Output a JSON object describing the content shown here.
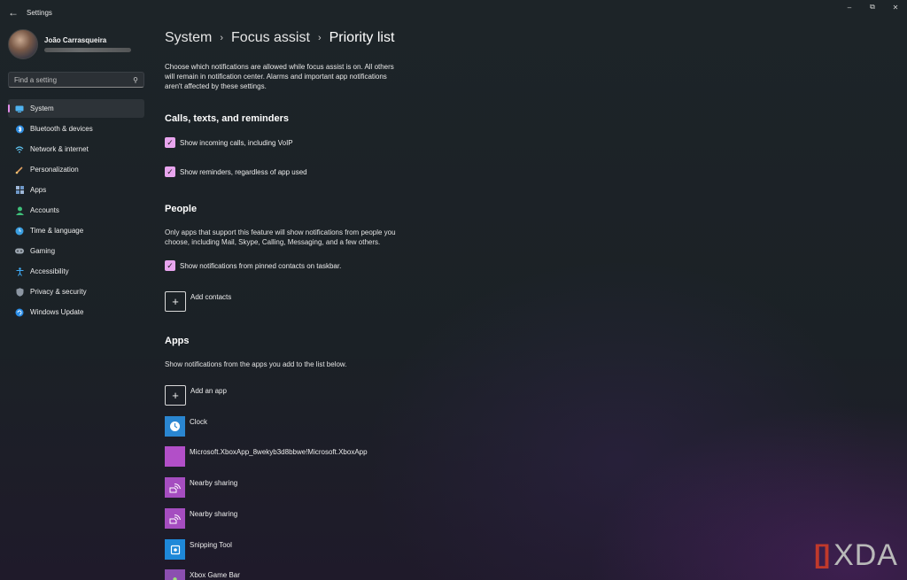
{
  "titlebar": {
    "back_icon": "back-arrow-icon",
    "title": "Settings",
    "controls": [
      "minimize-icon",
      "maximize-icon",
      "close-icon"
    ]
  },
  "profile": {
    "name": "João Carrasqueira"
  },
  "search": {
    "placeholder": "Find a setting",
    "icon": "search-icon"
  },
  "nav": {
    "accent": "#e28ce9",
    "items": [
      {
        "label": "System",
        "icon": "monitor-icon",
        "active": true
      },
      {
        "label": "Bluetooth & devices",
        "icon": "bluetooth-icon"
      },
      {
        "label": "Network & internet",
        "icon": "wifi-icon"
      },
      {
        "label": "Personalization",
        "icon": "brush-icon"
      },
      {
        "label": "Apps",
        "icon": "apps-grid-icon"
      },
      {
        "label": "Accounts",
        "icon": "person-icon"
      },
      {
        "label": "Time & language",
        "icon": "globe-clock-icon"
      },
      {
        "label": "Gaming",
        "icon": "gamepad-icon"
      },
      {
        "label": "Accessibility",
        "icon": "accessibility-icon"
      },
      {
        "label": "Privacy & security",
        "icon": "shield-icon"
      },
      {
        "label": "Windows Update",
        "icon": "refresh-icon"
      }
    ]
  },
  "breadcrumb": {
    "items": [
      "System",
      "Focus assist",
      "Priority list"
    ]
  },
  "intro": "Choose which notifications are allowed while focus assist is on. All others will remain in notification center. Alarms and important app notifications aren't affected by these settings.",
  "calls": {
    "title": "Calls, texts, and reminders",
    "option1": "Show incoming calls, including VoIP",
    "option2": "Show reminders, regardless of app used"
  },
  "people": {
    "title": "People",
    "description": "Only apps that support this feature will show notifications from people you choose, including Mail, Skype, Calling, Messaging, and a few others.",
    "option1": "Show notifications from pinned contacts on taskbar.",
    "add_label": "Add contacts"
  },
  "apps": {
    "title": "Apps",
    "description": "Show notifications from the apps you add to the list below.",
    "add_label": "Add an app",
    "list": [
      {
        "name": "Clock",
        "icon": "clock-icon"
      },
      {
        "name": "Microsoft.XboxApp_8wekyb3d8bbwe!Microsoft.XboxApp",
        "icon": "xbox-app-icon"
      },
      {
        "name": "Nearby sharing",
        "icon": "nearby-sharing-icon"
      },
      {
        "name": "Nearby sharing",
        "icon": "nearby-sharing-icon"
      },
      {
        "name": "Snipping Tool",
        "icon": "snipping-tool-icon"
      },
      {
        "name": "Xbox Game Bar",
        "icon": "xbox-game-bar-icon"
      }
    ]
  },
  "watermark": {
    "text": "XDA",
    "bracket_color": "#c0392b"
  }
}
